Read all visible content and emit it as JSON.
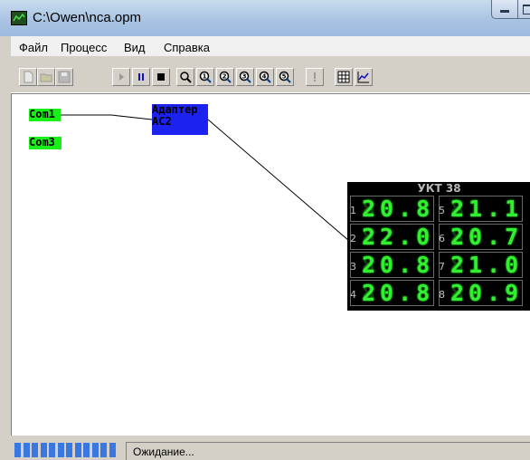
{
  "window": {
    "title": "C:\\Owen\\nca.opm",
    "app_icon": "chart-app-icon"
  },
  "menubar": {
    "items": [
      "Файл",
      "Процесс",
      "Вид",
      "Справка"
    ]
  },
  "toolbar": {
    "buttons": [
      {
        "name": "new-file-icon",
        "enabled": false
      },
      {
        "name": "open-folder-icon",
        "enabled": false
      },
      {
        "name": "save-disk-icon",
        "enabled": false
      },
      {
        "name": "play-icon",
        "enabled": false
      },
      {
        "name": "pause-icon",
        "enabled": true
      },
      {
        "name": "stop-icon",
        "enabled": true
      },
      {
        "name": "zoom-icon",
        "enabled": true
      },
      {
        "name": "zoom-1-icon",
        "enabled": true
      },
      {
        "name": "zoom-2-icon",
        "enabled": true
      },
      {
        "name": "zoom-3-icon",
        "enabled": true
      },
      {
        "name": "zoom-4-icon",
        "enabled": true
      },
      {
        "name": "zoom-5-icon",
        "enabled": true
      },
      {
        "name": "alert-icon",
        "enabled": false
      },
      {
        "name": "table-icon",
        "enabled": true
      },
      {
        "name": "chart-icon",
        "enabled": true
      }
    ]
  },
  "canvas": {
    "com_ports": [
      "Com1",
      "Com3"
    ],
    "adapter": {
      "line1": "Адаптер",
      "line2": "АС2"
    },
    "device": {
      "title": "УКТ 38",
      "channels": [
        {
          "n": "1",
          "value": "20.8"
        },
        {
          "n": "5",
          "value": "21.1"
        },
        {
          "n": "2",
          "value": "22.0"
        },
        {
          "n": "6",
          "value": "20.7"
        },
        {
          "n": "3",
          "value": "20.8"
        },
        {
          "n": "7",
          "value": "21.0"
        },
        {
          "n": "4",
          "value": "20.8"
        },
        {
          "n": "8",
          "value": "20.9"
        }
      ]
    },
    "node_color": "#18f018",
    "adapter_color": "#1c22f0",
    "digit_color": "#30f030"
  },
  "statusbar": {
    "text": "Ожидание...",
    "progress_color": "#3878e0"
  }
}
